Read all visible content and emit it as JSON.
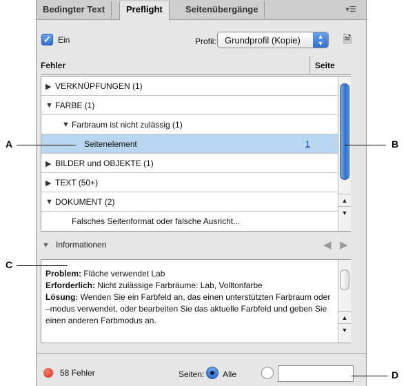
{
  "tabs": [
    {
      "label": "Bedingter Text",
      "active": false
    },
    {
      "label": "Preflight",
      "active": true
    },
    {
      "label": "Seitenübergänge",
      "active": false
    }
  ],
  "panel_menu_icon": "panel-menu-icon",
  "enable_checkbox": {
    "label": "Ein",
    "checked": true
  },
  "profile": {
    "label": "Profil:",
    "value": "Grundprofil (Kopie)"
  },
  "list": {
    "columns": {
      "error": "Fehler",
      "page": "Seite"
    },
    "rows": [
      {
        "label": "VERKNÜPFUNGEN (1)",
        "expanded": false,
        "level": 0
      },
      {
        "label": "FARBE (1)",
        "expanded": true,
        "level": 0
      },
      {
        "label": "Farbraum ist nicht zulässig (1)",
        "expanded": true,
        "level": 1
      },
      {
        "label": "Seitenelement",
        "level": 2,
        "selected": true,
        "page": "1"
      },
      {
        "label": "BILDER und OBJEKTE (1)",
        "expanded": false,
        "level": 0
      },
      {
        "label": "TEXT (50+)",
        "expanded": false,
        "level": 0
      },
      {
        "label": "DOKUMENT (2)",
        "expanded": true,
        "level": 0
      },
      {
        "label": "Falsches Seitenformat oder falsche Ausricht...",
        "level": 1
      }
    ]
  },
  "info": {
    "label": "Informationen",
    "problem_label": "Problem:",
    "problem_text": " Fläche verwendet Lab",
    "required_label": "Erforderlich:",
    "required_text": " Nicht zulässige Farbräume: Lab, Volltonfarbe",
    "solution_label": "Lösung:",
    "solution_text": " Wenden Sie ein Farbfeld an, das einen unterstützten Farbraum oder –modus verwendet, oder bearbeiten Sie das aktuelle Farbfeld und geben Sie einen anderen Farbmodus an."
  },
  "footer": {
    "error_count": "58 Fehler",
    "pages_label": "Seiten:",
    "all_label": "Alle",
    "range_value": ""
  },
  "callouts": [
    "A",
    "B",
    "C",
    "D"
  ],
  "colors": {
    "selection": "#b9d6f0",
    "accent": "#2f6fd0",
    "error_dot": "#d42a1a"
  }
}
